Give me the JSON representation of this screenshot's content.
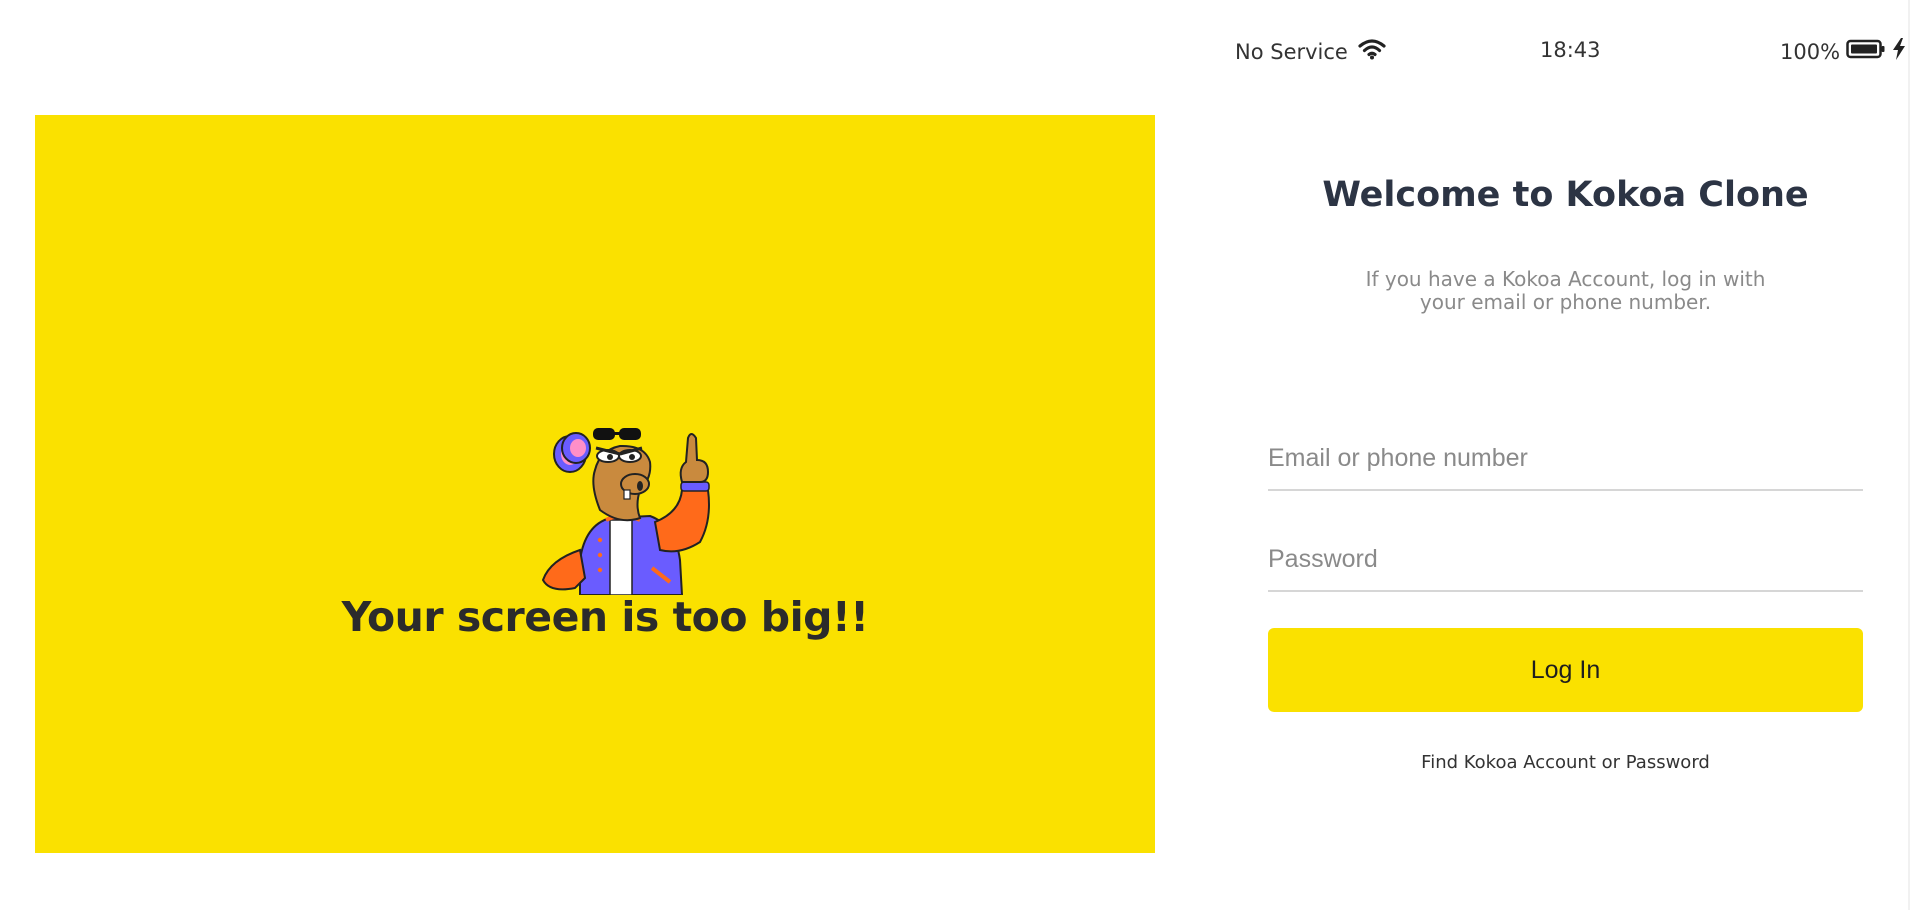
{
  "banner": {
    "message": "Your screen is too big!!",
    "background_color": "#fae100",
    "illustration": "mascot-pointing-up"
  },
  "status_bar": {
    "carrier": "No Service",
    "wifi_icon": "wifi-icon",
    "time": "18:43",
    "battery_percent": "100%",
    "battery_icon": "battery-full-icon",
    "charging_icon": "lightning-bolt-icon"
  },
  "welcome": {
    "title": "Welcome to Kokoa Clone",
    "description": "If you have a Kokoa Account, log in with your email or phone number."
  },
  "login_form": {
    "email_placeholder": "Email or phone number",
    "email_value": "",
    "password_placeholder": "Password",
    "password_value": "",
    "submit_label": "Log In",
    "accent_color": "#fae100"
  },
  "find_account": {
    "label": "Find Kokoa Account or Password"
  }
}
